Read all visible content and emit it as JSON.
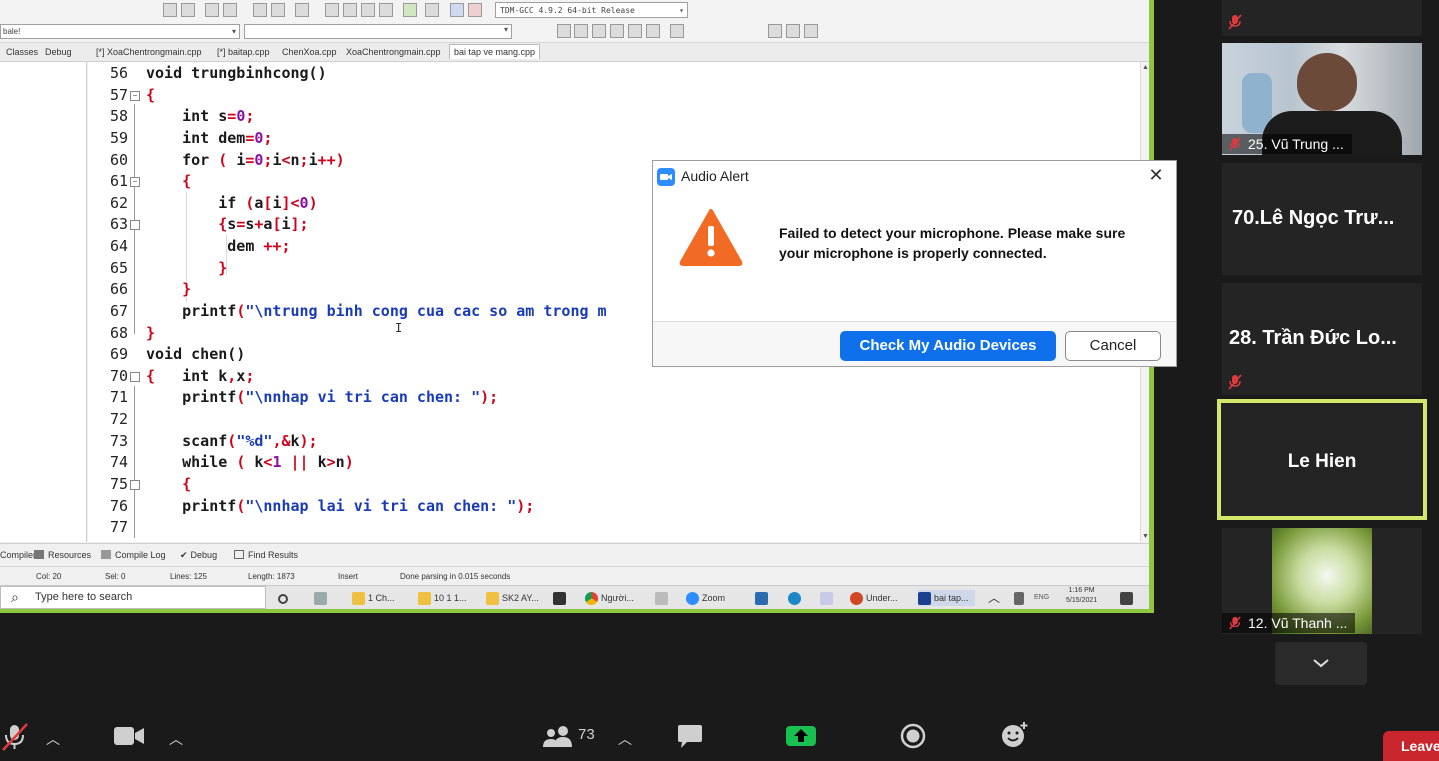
{
  "ide": {
    "compiler_select": "TDM-GCC 4.9.2 64-bit Release",
    "left_select": "bale!",
    "tabs": [
      "Classes",
      "Debug",
      "[*] XoaChentrongmain.cpp",
      "[*] baitap.cpp",
      "ChenXoa.cpp",
      "XoaChentrongmain.cpp",
      "bai tap ve mang.cpp"
    ],
    "code_lines": [
      {
        "n": "56",
        "parts": [
          [
            "kw",
            "void "
          ],
          [
            "p",
            "trungbinhcong()"
          ]
        ]
      },
      {
        "n": "57",
        "parts": [
          [
            "red",
            "{"
          ]
        ]
      },
      {
        "n": "58",
        "parts": [
          [
            "p",
            "    "
          ],
          [
            "kw",
            "int "
          ],
          [
            "p",
            "s"
          ],
          [
            "red",
            "="
          ],
          [
            "num",
            "0"
          ],
          [
            "red",
            ";"
          ]
        ]
      },
      {
        "n": "59",
        "parts": [
          [
            "p",
            "    "
          ],
          [
            "kw",
            "int "
          ],
          [
            "p",
            "dem"
          ],
          [
            "red",
            "="
          ],
          [
            "num",
            "0"
          ],
          [
            "red",
            ";"
          ]
        ]
      },
      {
        "n": "60",
        "parts": [
          [
            "p",
            "    "
          ],
          [
            "kw",
            "for "
          ],
          [
            "red",
            "( "
          ],
          [
            "p",
            "i"
          ],
          [
            "red",
            "="
          ],
          [
            "num",
            "0"
          ],
          [
            "red",
            ";"
          ],
          [
            "p",
            "i"
          ],
          [
            "red",
            "<"
          ],
          [
            "p",
            "n"
          ],
          [
            "red",
            ";"
          ],
          [
            "p",
            "i"
          ],
          [
            "red",
            "++)"
          ]
        ]
      },
      {
        "n": "61",
        "parts": [
          [
            "p",
            "    "
          ],
          [
            "red",
            "{"
          ]
        ]
      },
      {
        "n": "62",
        "parts": [
          [
            "p",
            "        "
          ],
          [
            "kw",
            "if "
          ],
          [
            "red",
            "("
          ],
          [
            "p",
            "a"
          ],
          [
            "red",
            "["
          ],
          [
            "p",
            "i"
          ],
          [
            "red",
            "]<"
          ],
          [
            "num",
            "0"
          ],
          [
            "red",
            ")"
          ]
        ]
      },
      {
        "n": "63",
        "parts": [
          [
            "p",
            "        "
          ],
          [
            "red",
            "{"
          ],
          [
            "p",
            "s"
          ],
          [
            "red",
            "="
          ],
          [
            "p",
            "s"
          ],
          [
            "red",
            "+"
          ],
          [
            "p",
            "a"
          ],
          [
            "red",
            "["
          ],
          [
            "p",
            "i"
          ],
          [
            "red",
            "];"
          ]
        ]
      },
      {
        "n": "64",
        "parts": [
          [
            "p",
            "         dem "
          ],
          [
            "red",
            "++;"
          ]
        ]
      },
      {
        "n": "65",
        "parts": [
          [
            "p",
            "        "
          ],
          [
            "red",
            "}"
          ]
        ]
      },
      {
        "n": "66",
        "parts": [
          [
            "p",
            "    "
          ],
          [
            "red",
            "}"
          ]
        ]
      },
      {
        "n": "67",
        "parts": [
          [
            "p",
            "    printf"
          ],
          [
            "red",
            "("
          ],
          [
            "str",
            "\"\\ntrung binh cong cua cac so am trong m"
          ]
        ]
      },
      {
        "n": "68",
        "parts": [
          [
            "red",
            "}"
          ]
        ]
      },
      {
        "n": "69",
        "parts": [
          [
            "kw",
            "void "
          ],
          [
            "p",
            "chen()"
          ]
        ]
      },
      {
        "n": "70",
        "parts": [
          [
            "red",
            "{"
          ],
          [
            "p",
            "   "
          ],
          [
            "kw",
            "int "
          ],
          [
            "p",
            "k"
          ],
          [
            "red",
            ","
          ],
          [
            "p",
            "x"
          ],
          [
            "red",
            ";"
          ]
        ]
      },
      {
        "n": "71",
        "parts": [
          [
            "p",
            "    printf"
          ],
          [
            "red",
            "("
          ],
          [
            "str",
            "\"\\nnhap vi tri can chen: \""
          ],
          [
            "red",
            ");"
          ]
        ]
      },
      {
        "n": "72",
        "parts": [
          [
            "p",
            ""
          ]
        ]
      },
      {
        "n": "73",
        "parts": [
          [
            "p",
            "    scanf"
          ],
          [
            "red",
            "("
          ],
          [
            "str",
            "\"%d\""
          ],
          [
            "red",
            ",&"
          ],
          [
            "p",
            "k"
          ],
          [
            "red",
            ");"
          ]
        ]
      },
      {
        "n": "74",
        "parts": [
          [
            "p",
            "    "
          ],
          [
            "kw",
            "while "
          ],
          [
            "red",
            "( "
          ],
          [
            "p",
            "k"
          ],
          [
            "red",
            "<"
          ],
          [
            "num",
            "1 "
          ],
          [
            "red",
            "|| "
          ],
          [
            "p",
            "k"
          ],
          [
            "red",
            ">"
          ],
          [
            "p",
            "n"
          ],
          [
            "red",
            ")"
          ]
        ]
      },
      {
        "n": "75",
        "parts": [
          [
            "p",
            "    "
          ],
          [
            "red",
            "{"
          ]
        ]
      },
      {
        "n": "76",
        "parts": [
          [
            "p",
            "    printf"
          ],
          [
            "red",
            "("
          ],
          [
            "str",
            "\"\\nnhap lai vi tri can chen: \""
          ],
          [
            "red",
            ");"
          ]
        ]
      },
      {
        "n": "77",
        "parts": [
          [
            "p",
            ""
          ]
        ]
      }
    ],
    "bottom_tabs": [
      "Compiler",
      "Resources",
      "Compile Log",
      "Debug",
      "Find Results"
    ],
    "status": {
      "col": "Col:  20",
      "sel": "Sel:  0",
      "lines": "Lines:  125",
      "length": "Length:  1873",
      "mode": "Insert",
      "message": "Done parsing in 0.015 seconds"
    },
    "taskbar": {
      "search_placeholder": "Type here to search",
      "items": [
        "1 Ch...",
        "10 1 1...",
        "SK2 AY...",
        "Người...",
        "Zoom",
        "Under...",
        "bai tap..."
      ],
      "time": "1:16 PM",
      "date": "5/15/2021"
    }
  },
  "dialog": {
    "title": "Audio Alert",
    "message": "Failed to detect your microphone. Please make sure your microphone is properly connected.",
    "primary_button": "Check My Audio Devices",
    "cancel_button": "Cancel"
  },
  "participants": [
    {
      "label": "25. Vũ Trung ...",
      "muted": true
    },
    {
      "name": "70.Lê Ngọc Trư..."
    },
    {
      "name": "28. Trần Đức Lo...",
      "muted": true
    },
    {
      "name": "Le Hien",
      "active_speaker": true
    },
    {
      "label": "12. Vũ Thanh ...",
      "muted": true
    }
  ],
  "meeting_bar": {
    "participant_count": "73",
    "leave_label": "Leave"
  },
  "colors": {
    "share_border": "#8dc63f",
    "active_speaker": "#d3e86a",
    "primary": "#0e71eb",
    "leave": "#c9252c",
    "warning": "#f26b24"
  }
}
